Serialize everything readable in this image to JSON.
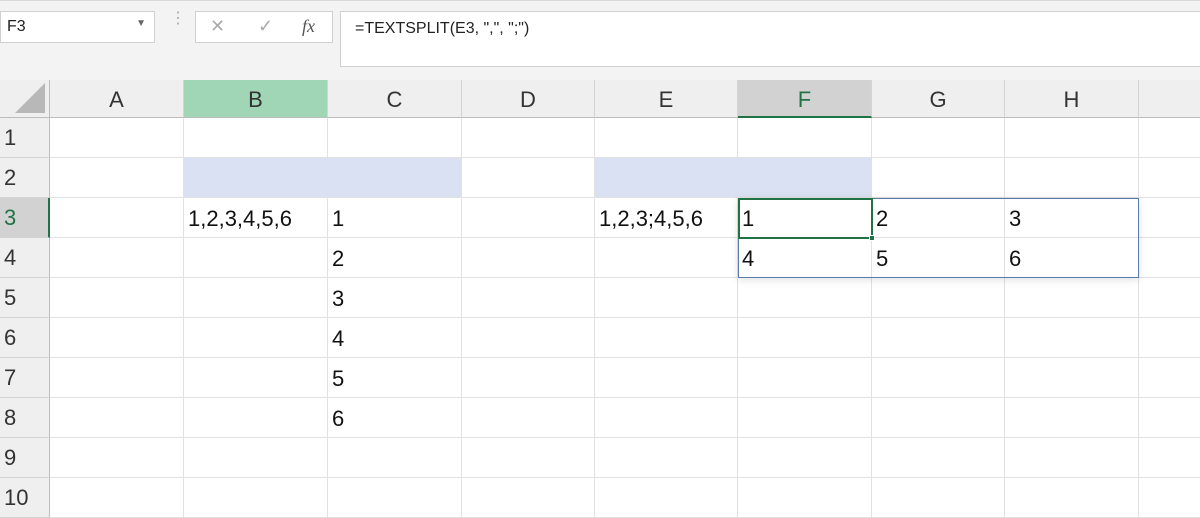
{
  "name_box": "F3",
  "formula_bar": {
    "cancel_icon": "✕",
    "enter_icon": "✓",
    "fx_label": "fx",
    "formula": "=TEXTSPLIT(E3, \",\", \";\")"
  },
  "columns": [
    "A",
    "B",
    "C",
    "D",
    "E",
    "F",
    "G",
    "H"
  ],
  "rows": [
    "1",
    "2",
    "3",
    "4",
    "5",
    "6",
    "7",
    "8",
    "9",
    "10"
  ],
  "cells": {
    "B3": "1,2,3,4,5,6",
    "C3": "1",
    "C4": "2",
    "C5": "3",
    "C6": "4",
    "C7": "5",
    "C8": "6",
    "E3": "1,2,3;4,5,6",
    "F3": "1",
    "G3": "2",
    "H3": "3",
    "F4": "4",
    "G4": "5",
    "H4": "6"
  },
  "colors": {
    "fill": "#d9e1f2",
    "accent": "#217346",
    "header_selected": "#a0d5b5",
    "spill_border": "#5a7aa8"
  }
}
